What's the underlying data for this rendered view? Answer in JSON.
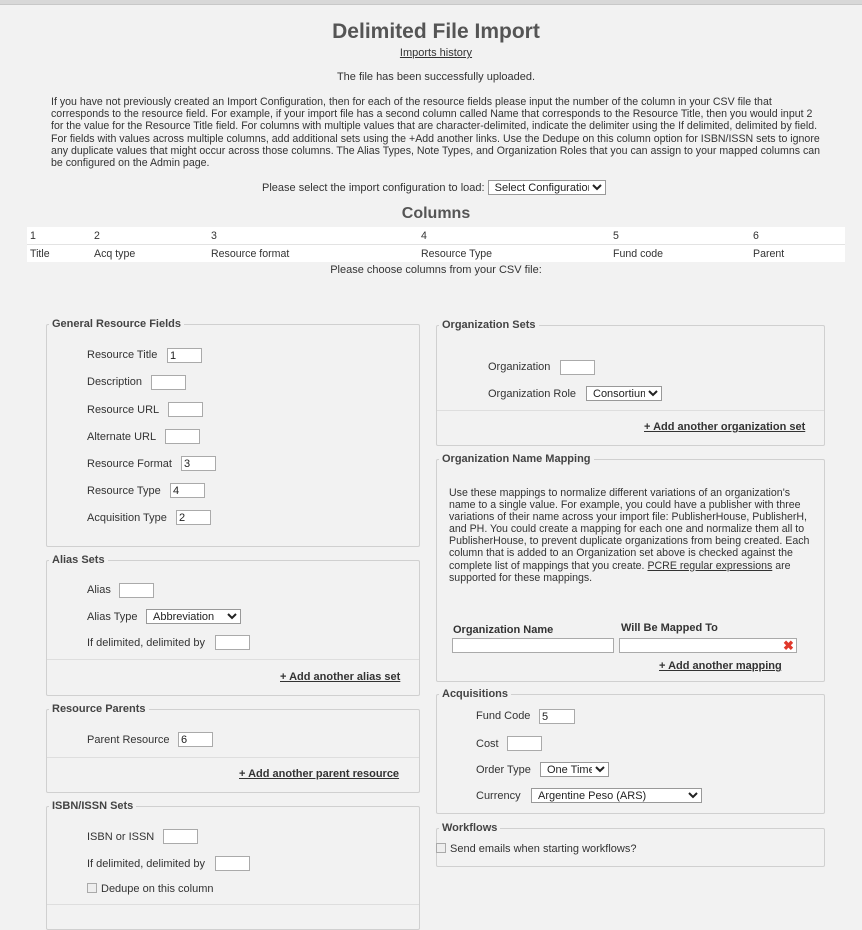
{
  "header": {
    "title": "Delimited File Import",
    "history_link": "Imports history",
    "upload_message": "The file has been successfully uploaded.",
    "instructions": "If you have not previously created an Import Configuration, then for each of the resource fields please input the number of the column in your CSV file that corresponds to the resource field. For example, if your import file has a second column called Name that corresponds to the Resource Title, then you would input 2 for the value for the Resource Title field. For columns with multiple values that are character-delimited, indicate the delimiter using the If delimited, delimited by field. For fields with values across multiple columns, add additional sets using the +Add another links. Use the Dedupe on this column option for ISBN/ISSN sets to ignore any duplicate values that might occur across those columns. The Alias Types, Note Types, and Organization Roles that you can assign to your mapped columns can be configured on the Admin page.",
    "config_label": "Please select the import configuration to load:",
    "config_select": "Select Configuration"
  },
  "columns": {
    "heading": "Columns",
    "numbers": [
      "1",
      "2",
      "3",
      "4",
      "5",
      "6"
    ],
    "names": [
      "Title",
      "Acq type",
      "Resource format",
      "Resource Type",
      "Fund code",
      "Parent"
    ],
    "choose_text": "Please choose columns from your CSV file:"
  },
  "general": {
    "legend": "General Resource Fields",
    "fields": [
      {
        "label": "Resource Title",
        "value": "1"
      },
      {
        "label": "Description",
        "value": ""
      },
      {
        "label": "Resource URL",
        "value": ""
      },
      {
        "label": "Alternate URL",
        "value": ""
      },
      {
        "label": "Resource Format",
        "value": "3"
      },
      {
        "label": "Resource Type",
        "value": "4"
      },
      {
        "label": "Acquisition Type",
        "value": "2"
      }
    ]
  },
  "alias": {
    "legend": "Alias Sets",
    "alias_label": "Alias",
    "alias_value": "",
    "type_label": "Alias Type",
    "type_value": "Abbreviation",
    "delim_label": "If delimited, delimited by",
    "delim_value": "",
    "add_link": "+ Add another alias set"
  },
  "parents": {
    "legend": "Resource Parents",
    "label": "Parent Resource",
    "value": "6",
    "add_link": "+ Add another parent resource"
  },
  "isbn": {
    "legend": "ISBN/ISSN Sets",
    "label": "ISBN or ISSN",
    "value": "",
    "delim_label": "If delimited, delimited by",
    "delim_value": "",
    "dedupe_label": "Dedupe on this column"
  },
  "org_sets": {
    "legend": "Organization Sets",
    "org_label": "Organization",
    "org_value": "",
    "role_label": "Organization Role",
    "role_value": "Consortium",
    "add_link": "+ Add another organization set"
  },
  "org_mapping": {
    "legend": "Organization Name Mapping",
    "description": "Use these mappings to normalize different variations of an organization's name to a single value. For example, you could have a publisher with three variations of their name across your import file: PublisherHouse, PublisherH, and PH. You could create a mapping for each one and normalize them all to PublisherHouse, to prevent duplicate organizations from being created. Each column that is added to an Organization set above is checked against the complete list of mappings that you create.",
    "regex_link": "PCRE regular expressions",
    "regex_suffix": " are supported for these mappings.",
    "col_name": "Organization Name",
    "col_mapped": "Will Be Mapped To",
    "name_value": "",
    "mapped_value": "",
    "add_link": "+ Add another mapping"
  },
  "acquisitions": {
    "legend": "Acquisitions",
    "fund_label": "Fund Code",
    "fund_value": "5",
    "cost_label": "Cost",
    "cost_value": "",
    "order_label": "Order Type",
    "order_value": "One Time",
    "currency_label": "Currency",
    "currency_value": "Argentine Peso (ARS)"
  },
  "workflows": {
    "legend": "Workflows",
    "email_label": "Send emails when starting workflows?"
  },
  "icons": {
    "delete": "close-icon",
    "dropdown": "chevron-down-icon",
    "delete_color": "#e0382b"
  }
}
